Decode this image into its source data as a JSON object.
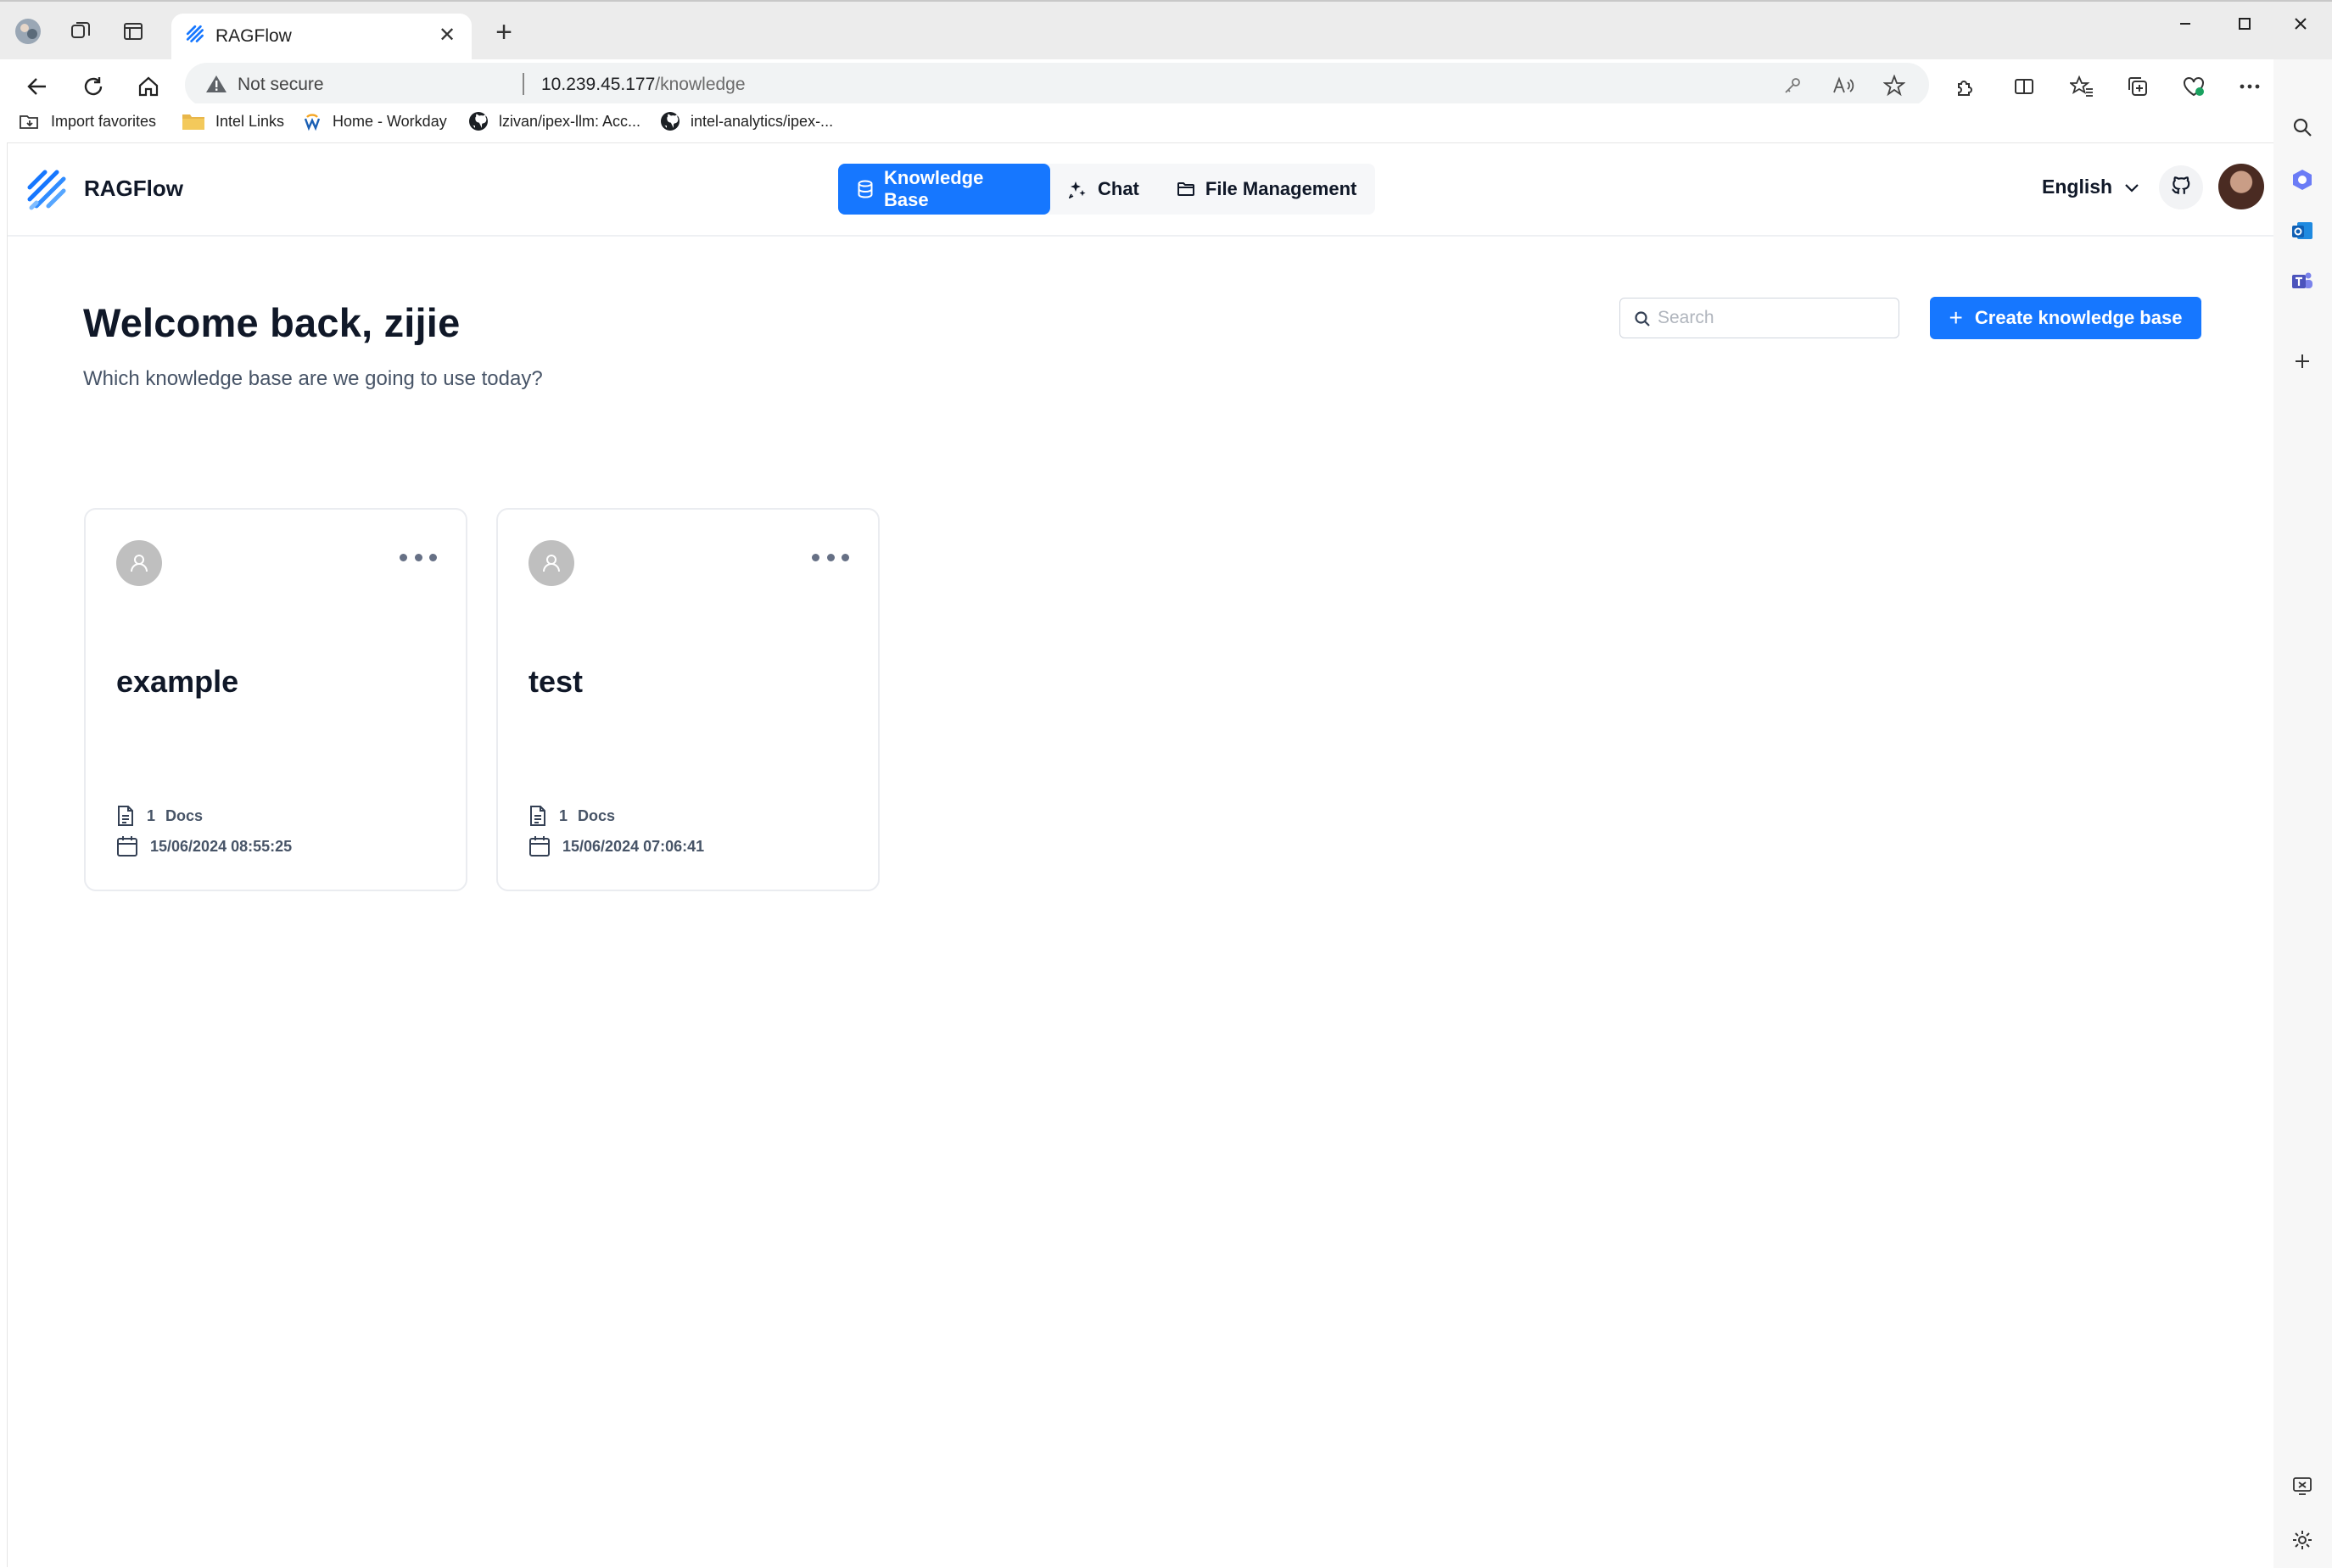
{
  "browser": {
    "tab_title": "RAGFlow",
    "address": {
      "security_label": "Not secure",
      "host": "10.239.45.177",
      "path": "/knowledge"
    },
    "bookmarks": [
      {
        "label": "Import favorites",
        "icon": "import-icon"
      },
      {
        "label": "Intel Links",
        "icon": "folder-icon"
      },
      {
        "label": "Home - Workday",
        "icon": "workday-icon"
      },
      {
        "label": "lzivan/ipex-llm: Acc...",
        "icon": "github-icon"
      },
      {
        "label": "intel-analytics/ipex-...",
        "icon": "github-icon"
      }
    ]
  },
  "app": {
    "brand": "RAGFlow",
    "nav": [
      {
        "label": "Knowledge Base",
        "icon": "database-icon",
        "active": true
      },
      {
        "label": "Chat",
        "icon": "chat-sparkle-icon",
        "active": false
      },
      {
        "label": "File Management",
        "icon": "folder-icon",
        "active": false
      }
    ],
    "language": "English"
  },
  "page": {
    "welcome": "Welcome back, zijie",
    "subtitle": "Which knowledge base are we going to use today?",
    "search_placeholder": "Search",
    "create_button": "Create knowledge base"
  },
  "knowledge_bases": [
    {
      "name": "example",
      "doc_count": "1",
      "doc_label": "Docs",
      "date": "15/06/2024 08:55:25"
    },
    {
      "name": "test",
      "doc_count": "1",
      "doc_label": "Docs",
      "date": "15/06/2024 07:06:41"
    }
  ],
  "colors": {
    "primary": "#1677ff",
    "text": "#101828",
    "muted": "#475467"
  }
}
